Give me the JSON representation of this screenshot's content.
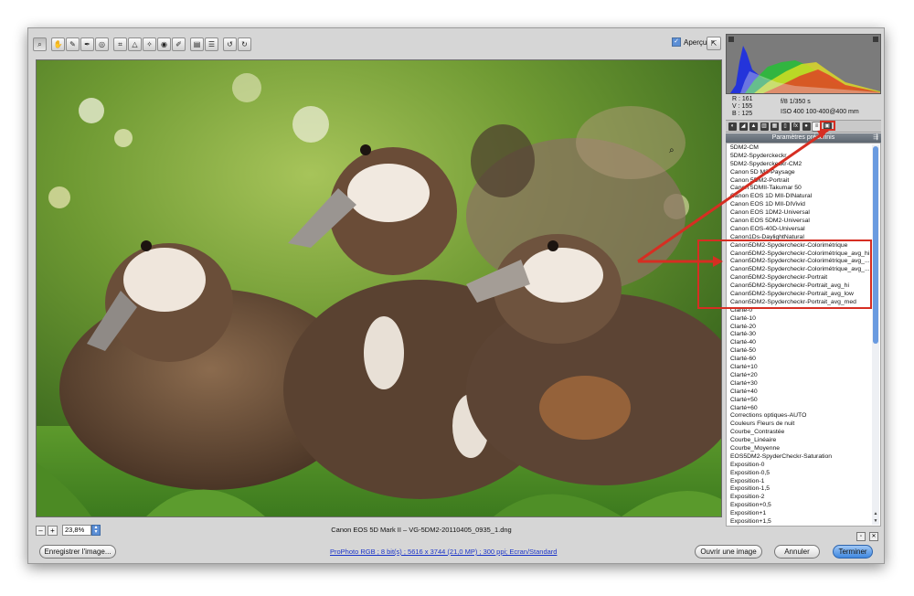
{
  "toolbar": {
    "tools": [
      {
        "name": "zoom-tool-icon",
        "glyph": "⌕",
        "active": true
      },
      {
        "name": "hand-tool-icon",
        "glyph": "✋",
        "active": false
      },
      {
        "name": "white-balance-tool-icon",
        "glyph": "✎",
        "active": false
      },
      {
        "name": "color-sampler-tool-icon",
        "glyph": "✒",
        "active": false
      },
      {
        "name": "targeted-adjustment-tool-icon",
        "glyph": "◎",
        "active": false
      },
      {
        "name": "crop-tool-icon",
        "glyph": "⌗",
        "active": false
      },
      {
        "name": "straighten-tool-icon",
        "glyph": "△",
        "active": false
      },
      {
        "name": "spot-removal-tool-icon",
        "glyph": "✧",
        "active": false
      },
      {
        "name": "red-eye-removal-tool-icon",
        "glyph": "◉",
        "active": false
      },
      {
        "name": "adjustment-brush-icon",
        "glyph": "✐",
        "active": false
      },
      {
        "name": "graduated-filter-icon",
        "glyph": "▤",
        "active": false
      },
      {
        "name": "preferences-icon",
        "glyph": "☰",
        "active": false
      },
      {
        "name": "rotate-left-icon",
        "glyph": "↺",
        "active": false
      },
      {
        "name": "rotate-right-icon",
        "glyph": "↻",
        "active": false
      }
    ],
    "preview_label": "Aperçu",
    "preview_checked": true,
    "fullscreen_glyph": "⇱"
  },
  "image_footer": {
    "zoom_out": "–",
    "zoom_in": "+",
    "zoom_value": "23,8%",
    "filename": "Canon EOS 5D Mark II  –  VG-5DM2-20110405_0935_1.dng"
  },
  "readout": {
    "r": "R :  161",
    "v": "V :  155",
    "b": "B :  125",
    "aperture_shutter": "f/8    1/350 s",
    "iso_lens": "ISO 400    100-400@400 mm"
  },
  "panel": {
    "tabs": [
      {
        "name": "tab-basic-icon",
        "glyph": "◐",
        "active": false
      },
      {
        "name": "tab-tone-curve-icon",
        "glyph": "◢",
        "active": false
      },
      {
        "name": "tab-detail-icon",
        "glyph": "▲",
        "active": false
      },
      {
        "name": "tab-hsl-icon",
        "glyph": "▥",
        "active": false
      },
      {
        "name": "tab-split-toning-icon",
        "glyph": "▦",
        "active": false
      },
      {
        "name": "tab-lens-corrections-icon",
        "glyph": "▯",
        "active": false
      },
      {
        "name": "tab-effects-icon",
        "glyph": "fx",
        "active": false
      },
      {
        "name": "tab-camera-calibration-icon",
        "glyph": "●",
        "active": false
      },
      {
        "name": "tab-presets-icon",
        "glyph": "≡",
        "active": true
      },
      {
        "name": "tab-snapshots-icon",
        "glyph": "▣",
        "active": false
      }
    ],
    "presets_title": "Paramètres prédéfinis",
    "presets_menu": "⇶",
    "presets": [
      "5DM2-CM",
      "5DM2-Spyderckeckr",
      "5DM2-Spyderckeckr-CM2",
      "Canon 5D M2-Paysage",
      "Canon 5DM2-Portrait",
      "Canon 5DMII-Takumar 50",
      "Canon EOS 1D MII-DINatural",
      "Canon EOS 1D MII-DIVivid",
      "Canon EOS 1DM2-Universal",
      "Canon EOS 5DM2-Universal",
      "Canon EOS-40D-Universal",
      "Canon1Ds-DaylightNatural",
      "Canon5DM2-Spydercheckr-Colorimétrique",
      "Canon5DM2-Spydercheckr-Colorimétrique_avg_hi",
      "Canon5DM2-Spydercheckr-Colorimétrique_avg_...",
      "Canon5DM2-Spydercheckr-Colorimétrique_avg_...",
      "Canon5DM2-Spydercheckr-Portrait",
      "Canon5DM2-Spydercheckr-Portrait_avg_hi",
      "Canon5DM2-Spydercheckr-Portrait_avg_low",
      "Canon5DM2-Spydercheckr-Portrait_avg_med",
      "Clarté-0",
      "Clarté-10",
      "Clarté-20",
      "Clarté-30",
      "Clarté-40",
      "Clarté-50",
      "Clarté-60",
      "Clarté+10",
      "Clarté+20",
      "Clarté+30",
      "Clarté+40",
      "Clarté+50",
      "Clarté+60",
      "Corrections optiques-AUTO",
      "Couleurs Fleurs de nuit",
      "Courbe_Contrastée",
      "Courbe_Linéaire",
      "Courbe_Moyenne",
      "EOS5DM2-SpyderCheckr-Saturation",
      "Exposition-0",
      "Exposition-0,5",
      "Exposition-1",
      "Exposition-1,5",
      "Exposition-2",
      "Exposition+0,5",
      "Exposition+1",
      "Exposition+1,5"
    ]
  },
  "bottom": {
    "save_label": "Enregistrer l'image...",
    "workflow_link": "ProPhoto RGB ; 8 bit(s) ; 5616 x 3744 (21,0 MP) ; 300 ppi; Ecran/Standard",
    "open_label": "Ouvrir une image",
    "cancel_label": "Annuler",
    "done_label": "Terminer"
  },
  "colors": {
    "highlight": "#d62e22",
    "accent": "#3f88e0"
  }
}
